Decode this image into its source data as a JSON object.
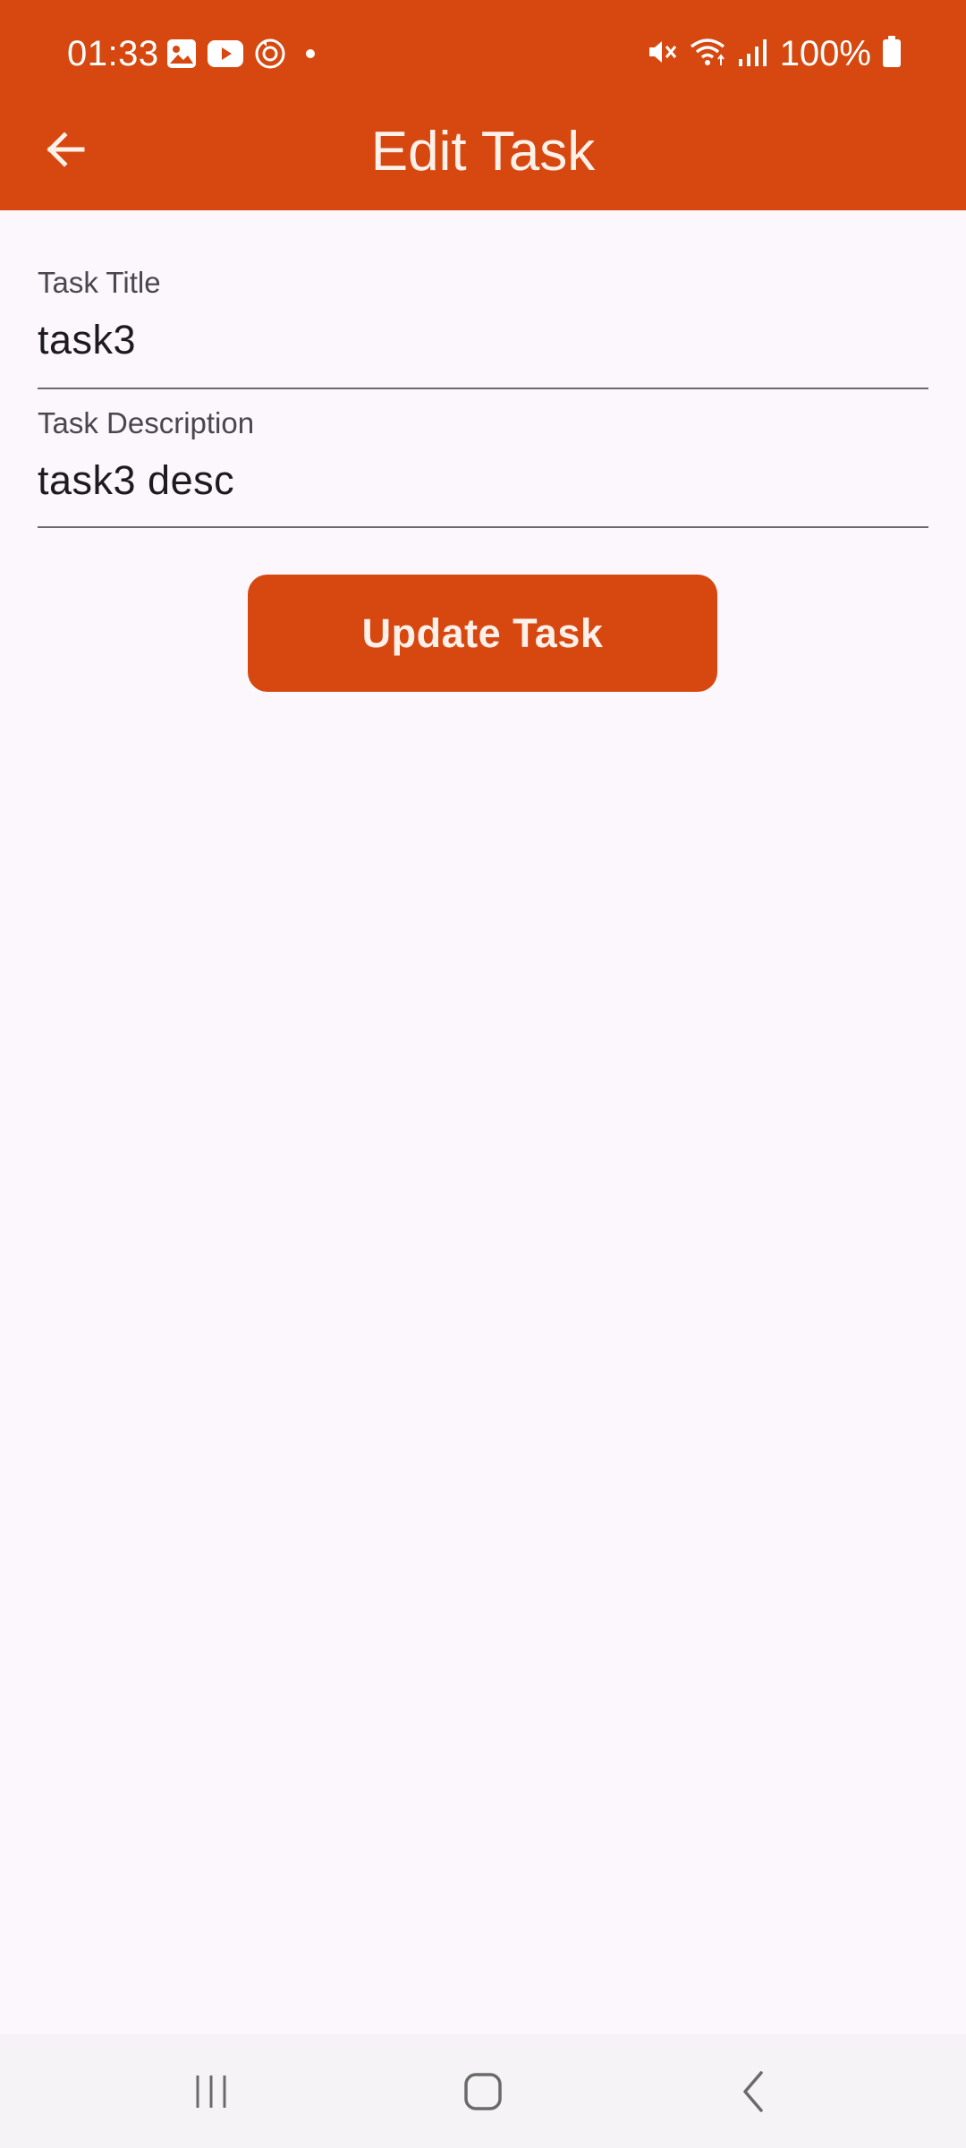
{
  "status_bar": {
    "time": "01:33",
    "left_icons": [
      "gallery-icon",
      "youtube-icon",
      "sync-icon",
      "dot-icon"
    ],
    "right_icons": [
      "mute-icon",
      "wifi-icon",
      "signal-icon"
    ],
    "battery": "100%"
  },
  "app_bar": {
    "title": "Edit Task",
    "back_icon": "arrow-back-icon"
  },
  "form": {
    "title_label": "Task Title",
    "title_value": "task3",
    "description_label": "Task Description",
    "description_value": "task3 desc",
    "submit_label": "Update Task"
  },
  "colors": {
    "accent": "#d64810",
    "background": "#fcf7fc",
    "on_accent": "#fff1ea",
    "nav_bar": "#f5f3f5"
  },
  "nav_bar": {
    "buttons": [
      "recents-icon",
      "home-icon",
      "back-icon"
    ]
  }
}
